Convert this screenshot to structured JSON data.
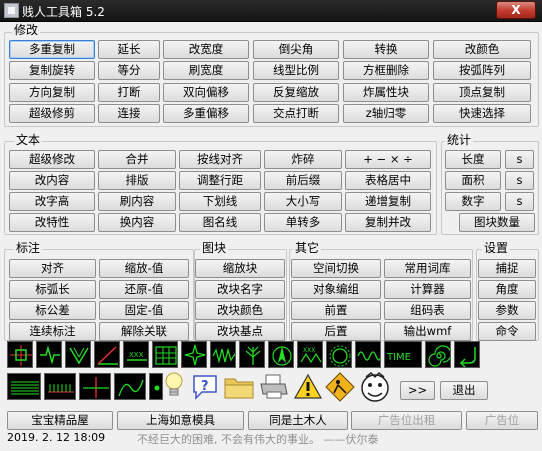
{
  "window": {
    "title": "贱人工具箱 5.2",
    "close_label": "X"
  },
  "modify": {
    "label": "修改",
    "rows": [
      [
        "多重复制",
        "延长",
        "改宽度",
        "倒尖角",
        "转换",
        "改颜色"
      ],
      [
        "复制旋转",
        "等分",
        "刷宽度",
        "线型比例",
        "方框删除",
        "按弧阵列"
      ],
      [
        "方向复制",
        "打断",
        "双向偏移",
        "反复缩放",
        "炸属性块",
        "顶点复制"
      ],
      [
        "超级修剪",
        "连接",
        "多重偏移",
        "交点打断",
        "z轴归零",
        "快速选择"
      ]
    ]
  },
  "text": {
    "label": "文本",
    "rows": [
      [
        "超级修改",
        "合并",
        "按线对齐",
        "炸碎",
        "+ − × ÷"
      ],
      [
        "改内容",
        "排版",
        "调整行距",
        "前后缀",
        "表格居中"
      ],
      [
        "改字高",
        "刷内容",
        "下划线",
        "大小写",
        "递增复制"
      ],
      [
        "改特性",
        "换内容",
        "图名线",
        "单转多",
        "复制并改"
      ]
    ]
  },
  "stats": {
    "label": "统计",
    "items": [
      {
        "name": "长度",
        "s": "s"
      },
      {
        "name": "面积",
        "s": "s"
      },
      {
        "name": "数字",
        "s": "s"
      }
    ],
    "block_count": "图块数量"
  },
  "annotate": {
    "label": "标注",
    "rows": [
      [
        "对齐",
        "缩放-值"
      ],
      [
        "标弧长",
        "还原-值"
      ],
      [
        "标公差",
        "固定-值"
      ],
      [
        "连续标注",
        "解除关联"
      ]
    ]
  },
  "block": {
    "label": "图块",
    "items": [
      "缩放块",
      "改块名字",
      "改块颜色",
      "改块基点"
    ]
  },
  "other": {
    "label": "其它",
    "rows": [
      [
        "空间切换",
        "常用词库"
      ],
      [
        "对象编组",
        "计算器"
      ],
      [
        "前置",
        "组码表"
      ],
      [
        "后置",
        "输出wmf"
      ]
    ]
  },
  "settings": {
    "label": "设置",
    "items": [
      "捕捉",
      "角度",
      "参数",
      "命令"
    ]
  },
  "icons_row1": [
    "center-mark-icon",
    "break-line-icon",
    "leader-icon",
    "angle-icon",
    "dimension-icon",
    "table-grid-icon",
    "star-spline-icon",
    "zigzag-icon",
    "plant-icon",
    "compass-icon",
    "hatch-icon",
    "gear-icon",
    "wave-icon",
    "time-text-icon",
    "spiral-icon",
    "return-arrow-icon"
  ],
  "icon_texts": {
    "time": "TIME",
    "xxx": "XXX"
  },
  "icons_row2": [
    "spring-icon",
    "comb-icon",
    "cross-icon",
    "curve-icon",
    "dot-icon",
    "lightbulb-icon",
    "help-icon",
    "folder-icon",
    "printer-icon",
    "warning-icon",
    "construction-icon",
    "mascot-icon"
  ],
  "nav": {
    "next_label": ">>",
    "exit_label": "退出"
  },
  "links": [
    "宝宝精品屋",
    "上海如意模具",
    "同是土木人",
    "广告位出租",
    "广告位"
  ],
  "status": {
    "datetime": "2019. 2. 12   18:09",
    "slogan": "不经巨大的困难, 不会有伟大的事业。 ——伏尔泰"
  },
  "colors": {
    "icon_green": "#22dd22",
    "icon_bg": "#000000",
    "title_bar": "#1d1d1d",
    "close": "#c0392b",
    "selected_border": "#3a7fd6"
  }
}
